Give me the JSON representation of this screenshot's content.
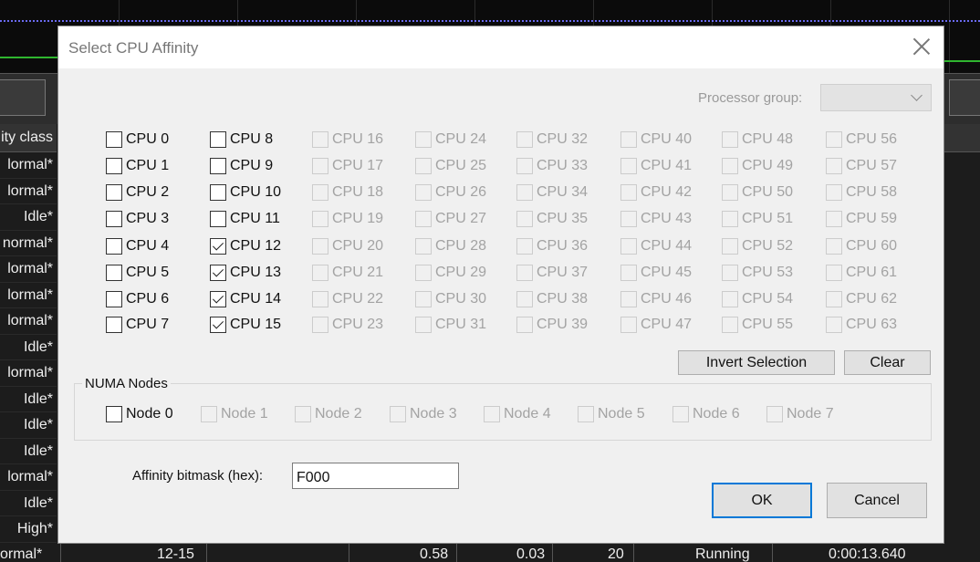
{
  "background": {
    "column_header": "ity class",
    "rows": [
      "lormal*",
      "lormal*",
      "Idle*",
      "normal*",
      "lormal*",
      "lormal*",
      "lormal*",
      "Idle*",
      "lormal*",
      "Idle*",
      "Idle*",
      "Idle*",
      "lormal*",
      "Idle*",
      "High*"
    ],
    "bottom_row": {
      "priority": "ormal*",
      "affinity": "12-15",
      "cpu": "0.58",
      "value2": "0.03",
      "threads": "20",
      "status": "Running",
      "time": "0:00:13.640"
    }
  },
  "dialog": {
    "title": "Select CPU Affinity",
    "processor_group_label": "Processor group:",
    "processor_group_value": "",
    "cpus": [
      {
        "label": "CPU 0",
        "checked": false,
        "enabled": true
      },
      {
        "label": "CPU 1",
        "checked": false,
        "enabled": true
      },
      {
        "label": "CPU 2",
        "checked": false,
        "enabled": true
      },
      {
        "label": "CPU 3",
        "checked": false,
        "enabled": true
      },
      {
        "label": "CPU 4",
        "checked": false,
        "enabled": true
      },
      {
        "label": "CPU 5",
        "checked": false,
        "enabled": true
      },
      {
        "label": "CPU 6",
        "checked": false,
        "enabled": true
      },
      {
        "label": "CPU 7",
        "checked": false,
        "enabled": true
      },
      {
        "label": "CPU 8",
        "checked": false,
        "enabled": true
      },
      {
        "label": "CPU 9",
        "checked": false,
        "enabled": true
      },
      {
        "label": "CPU 10",
        "checked": false,
        "enabled": true
      },
      {
        "label": "CPU 11",
        "checked": false,
        "enabled": true
      },
      {
        "label": "CPU 12",
        "checked": true,
        "enabled": true
      },
      {
        "label": "CPU 13",
        "checked": true,
        "enabled": true
      },
      {
        "label": "CPU 14",
        "checked": true,
        "enabled": true
      },
      {
        "label": "CPU 15",
        "checked": true,
        "enabled": true
      },
      {
        "label": "CPU 16",
        "checked": false,
        "enabled": false
      },
      {
        "label": "CPU 17",
        "checked": false,
        "enabled": false
      },
      {
        "label": "CPU 18",
        "checked": false,
        "enabled": false
      },
      {
        "label": "CPU 19",
        "checked": false,
        "enabled": false
      },
      {
        "label": "CPU 20",
        "checked": false,
        "enabled": false
      },
      {
        "label": "CPU 21",
        "checked": false,
        "enabled": false
      },
      {
        "label": "CPU 22",
        "checked": false,
        "enabled": false
      },
      {
        "label": "CPU 23",
        "checked": false,
        "enabled": false
      },
      {
        "label": "CPU 24",
        "checked": false,
        "enabled": false
      },
      {
        "label": "CPU 25",
        "checked": false,
        "enabled": false
      },
      {
        "label": "CPU 26",
        "checked": false,
        "enabled": false
      },
      {
        "label": "CPU 27",
        "checked": false,
        "enabled": false
      },
      {
        "label": "CPU 28",
        "checked": false,
        "enabled": false
      },
      {
        "label": "CPU 29",
        "checked": false,
        "enabled": false
      },
      {
        "label": "CPU 30",
        "checked": false,
        "enabled": false
      },
      {
        "label": "CPU 31",
        "checked": false,
        "enabled": false
      },
      {
        "label": "CPU 32",
        "checked": false,
        "enabled": false
      },
      {
        "label": "CPU 33",
        "checked": false,
        "enabled": false
      },
      {
        "label": "CPU 34",
        "checked": false,
        "enabled": false
      },
      {
        "label": "CPU 35",
        "checked": false,
        "enabled": false
      },
      {
        "label": "CPU 36",
        "checked": false,
        "enabled": false
      },
      {
        "label": "CPU 37",
        "checked": false,
        "enabled": false
      },
      {
        "label": "CPU 38",
        "checked": false,
        "enabled": false
      },
      {
        "label": "CPU 39",
        "checked": false,
        "enabled": false
      },
      {
        "label": "CPU 40",
        "checked": false,
        "enabled": false
      },
      {
        "label": "CPU 41",
        "checked": false,
        "enabled": false
      },
      {
        "label": "CPU 42",
        "checked": false,
        "enabled": false
      },
      {
        "label": "CPU 43",
        "checked": false,
        "enabled": false
      },
      {
        "label": "CPU 44",
        "checked": false,
        "enabled": false
      },
      {
        "label": "CPU 45",
        "checked": false,
        "enabled": false
      },
      {
        "label": "CPU 46",
        "checked": false,
        "enabled": false
      },
      {
        "label": "CPU 47",
        "checked": false,
        "enabled": false
      },
      {
        "label": "CPU 48",
        "checked": false,
        "enabled": false
      },
      {
        "label": "CPU 49",
        "checked": false,
        "enabled": false
      },
      {
        "label": "CPU 50",
        "checked": false,
        "enabled": false
      },
      {
        "label": "CPU 51",
        "checked": false,
        "enabled": false
      },
      {
        "label": "CPU 52",
        "checked": false,
        "enabled": false
      },
      {
        "label": "CPU 53",
        "checked": false,
        "enabled": false
      },
      {
        "label": "CPU 54",
        "checked": false,
        "enabled": false
      },
      {
        "label": "CPU 55",
        "checked": false,
        "enabled": false
      },
      {
        "label": "CPU 56",
        "checked": false,
        "enabled": false
      },
      {
        "label": "CPU 57",
        "checked": false,
        "enabled": false
      },
      {
        "label": "CPU 58",
        "checked": false,
        "enabled": false
      },
      {
        "label": "CPU 59",
        "checked": false,
        "enabled": false
      },
      {
        "label": "CPU 60",
        "checked": false,
        "enabled": false
      },
      {
        "label": "CPU 61",
        "checked": false,
        "enabled": false
      },
      {
        "label": "CPU 62",
        "checked": false,
        "enabled": false
      },
      {
        "label": "CPU 63",
        "checked": false,
        "enabled": false
      }
    ],
    "invert_label": "Invert Selection",
    "clear_label": "Clear",
    "numa_label": "NUMA Nodes",
    "nodes": [
      {
        "label": "Node 0",
        "checked": false,
        "enabled": true
      },
      {
        "label": "Node 1",
        "checked": false,
        "enabled": false
      },
      {
        "label": "Node 2",
        "checked": false,
        "enabled": false
      },
      {
        "label": "Node 3",
        "checked": false,
        "enabled": false
      },
      {
        "label": "Node 4",
        "checked": false,
        "enabled": false
      },
      {
        "label": "Node 5",
        "checked": false,
        "enabled": false
      },
      {
        "label": "Node 6",
        "checked": false,
        "enabled": false
      },
      {
        "label": "Node 7",
        "checked": false,
        "enabled": false
      }
    ],
    "bitmask_label": "Affinity bitmask (hex):",
    "bitmask_value": "F000",
    "ok_label": "OK",
    "cancel_label": "Cancel"
  }
}
